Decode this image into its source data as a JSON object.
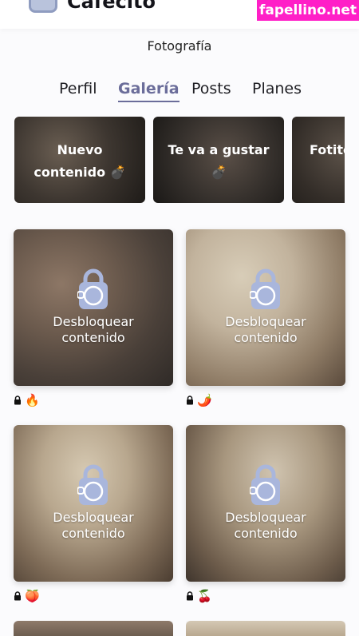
{
  "header": {
    "brand": "Cafecito",
    "watermark": "fapellino.net",
    "category": "Fotografía"
  },
  "tabs": [
    {
      "label": "Perfil",
      "active": false
    },
    {
      "label": "Galería",
      "active": true
    },
    {
      "label": "Posts",
      "active": false
    },
    {
      "label": "Planes",
      "active": false
    }
  ],
  "collections": [
    {
      "label": "Nuevo contenido 💣"
    },
    {
      "label": "Te va a gustar 💣"
    },
    {
      "label": "Fotito"
    }
  ],
  "gallery": {
    "unlock_label_line1": "Desbloquear",
    "unlock_label_line2": "contenido",
    "items": [
      {
        "emoji": "🔥",
        "emoji_name": "fire-icon"
      },
      {
        "emoji": "🌶️",
        "emoji_name": "chili-pepper-icon"
      },
      {
        "emoji": "🍑",
        "emoji_name": "peach-icon"
      },
      {
        "emoji": "🍒",
        "emoji_name": "cherries-icon"
      }
    ]
  },
  "colors": {
    "accent": "#6b6d9a",
    "watermark_bg": "#ff1fc7",
    "lock_fill": "#a9b6dc"
  }
}
